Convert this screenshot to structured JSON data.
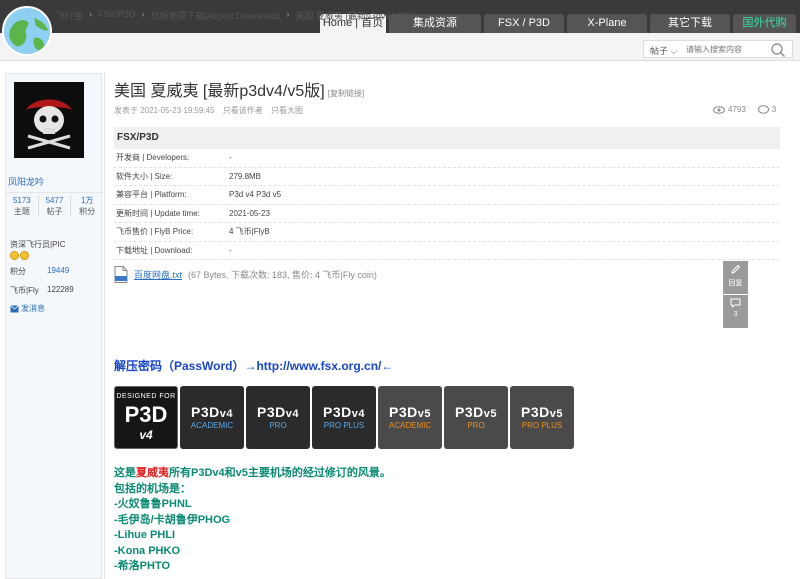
{
  "nav": {
    "tabs": [
      {
        "label": "Home | 首页",
        "active": true
      },
      {
        "label": "集成资源",
        "active": false
      },
      {
        "label": "FSX / P3D",
        "active": false
      },
      {
        "label": "X-Plane",
        "active": false
      },
      {
        "label": "其它下载",
        "active": false
      },
      {
        "label": "国外代购",
        "active": false,
        "highlight": true
      }
    ]
  },
  "breadcrumb": [
    "飞行宝",
    "FSX/P3D",
    "机场地景下载|Airport Downloads",
    "美国 夏威夷 [最新p3dv4/v5版]"
  ],
  "search": {
    "type_label": "帖子",
    "placeholder": "请输入搜索内容",
    "value": ""
  },
  "sidebar": {
    "username": "凤阳龙吟",
    "stats": [
      {
        "num": "5173",
        "label": "主题"
      },
      {
        "num": "5477",
        "label": "帖子"
      },
      {
        "num": "1万",
        "label": "积分"
      }
    ],
    "rank": "资深飞行员|PIC",
    "points_label": "积分",
    "points_value": "19449",
    "coin_label": "飞币|Fly",
    "coin_value": "122289",
    "message_label": "发消息"
  },
  "post": {
    "title": "美国 夏威夷 [最新p3dv4/v5版]",
    "copy_link": "[复制链接]",
    "posted": "发表于 2021-05-23 19:59:45",
    "only_author": "只看该作者",
    "only_large_image": "只看大图",
    "views": "4793",
    "replies": "3"
  },
  "info": {
    "header": "FSX/P3D",
    "rows": [
      {
        "k": "开发商 | Developers:",
        "v": "-"
      },
      {
        "k": "软件大小 | Size:",
        "v": "279.8MB"
      },
      {
        "k": "兼容平台 | Platform:",
        "v": "P3d v4 P3d v5"
      },
      {
        "k": "更新时间 | Update time:",
        "v": "2021-05-23"
      },
      {
        "k": "飞币售价 | FlyB Price:",
        "v": "4 飞币|FlyB"
      },
      {
        "k": "下载地址 | Download:",
        "v": "-"
      }
    ]
  },
  "attachment": {
    "name": "百度网盘.txt",
    "detail": "(67 Bytes, 下载次数: 183, 售价: 4 飞币|Fly coin)"
  },
  "tools": {
    "reply_label": "回复",
    "comment_count": "3"
  },
  "password_line": "解压密码（PassWord）→http://www.fsx.org.cn/←",
  "banner": {
    "designed_top": "DESIGNED FOR",
    "designed_big": "P3D",
    "designed_version": "v4",
    "badges": [
      {
        "label": "P3D",
        "ver": "v4",
        "sub": "ACADEMIC",
        "kind": "v4"
      },
      {
        "label": "P3D",
        "ver": "v4",
        "sub": "PRO",
        "kind": "v4"
      },
      {
        "label": "P3D",
        "ver": "v4",
        "sub": "PRO PLUS",
        "kind": "v4"
      },
      {
        "label": "P3D",
        "ver": "v5",
        "sub": "ACADEMIC",
        "kind": "v5"
      },
      {
        "label": "P3D",
        "ver": "v5",
        "sub": "PRO",
        "kind": "v5"
      },
      {
        "label": "P3D",
        "ver": "v5",
        "sub": "PRO PLUS",
        "kind": "v5"
      }
    ]
  },
  "description": {
    "intro_pre": "这是",
    "intro_red": "夏威夷",
    "intro_post": "所有P3Dv4和v5主要机场的经过修订的风景。",
    "list_label": "包括的机场是：",
    "airports": [
      "-火奴鲁鲁PHNL",
      "-毛伊岛/卡胡鲁伊PHOG",
      "-Lihue PHLI",
      "-Kona PHKO",
      "-希洛PHTO"
    ]
  },
  "colors": {
    "accent_blue": "#2a6fbd",
    "password_blue": "#1846c8",
    "desc_green": "#0b8a73",
    "highlight_red": "#e02020",
    "nav_dark": "#3a3a3a"
  }
}
